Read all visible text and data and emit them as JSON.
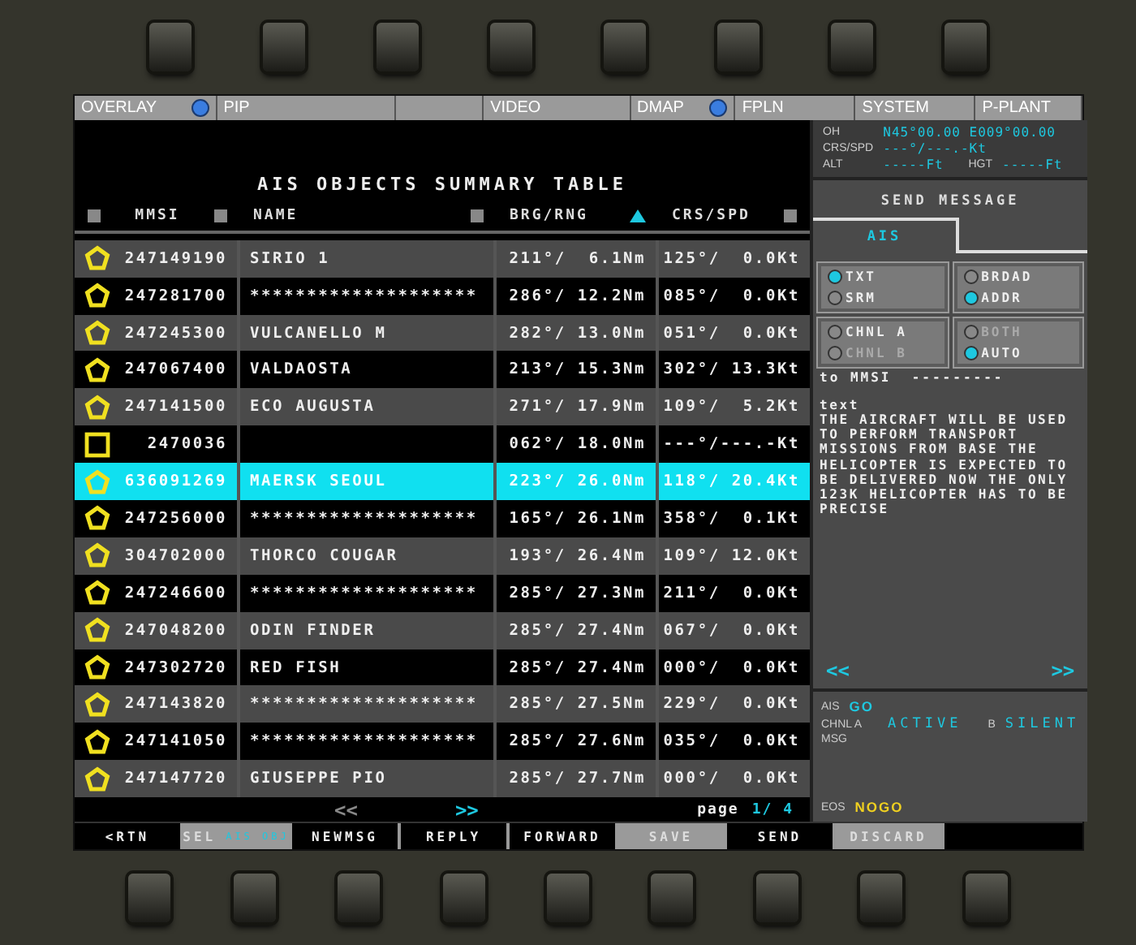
{
  "menu_bar": [
    {
      "label": "OVERLAY",
      "indicator": true
    },
    {
      "label": "PIP",
      "indicator": false
    },
    {
      "indicator": false
    },
    {
      "label": "VIDEO",
      "indicator": false
    },
    {
      "label": "DMAP",
      "indicator": true
    },
    {
      "label": "FPLN",
      "indicator": false
    },
    {
      "label": "SYSTEM",
      "indicator": false
    },
    {
      "label": "P-PLANT",
      "indicator": false
    }
  ],
  "table": {
    "title": "AIS OBJECTS SUMMARY TABLE",
    "columns": [
      "MMSI",
      "NAME",
      "BRG/RNG",
      "CRS/SPD"
    ],
    "rows": [
      {
        "kind": "pentagon",
        "selected": false,
        "mmsi": "247149190",
        "name": "SIRIO 1",
        "brg_rng": "211°/  6.1Nm",
        "crs_spd": "125°/  0.0Kt"
      },
      {
        "kind": "pentagon",
        "selected": false,
        "mmsi": "247281700",
        "name": "********************",
        "brg_rng": "286°/ 12.2Nm",
        "crs_spd": "085°/  0.0Kt"
      },
      {
        "kind": "pentagon",
        "selected": false,
        "mmsi": "247245300",
        "name": "VULCANELLO M",
        "brg_rng": "282°/ 13.0Nm",
        "crs_spd": "051°/  0.0Kt"
      },
      {
        "kind": "pentagon",
        "selected": false,
        "mmsi": "247067400",
        "name": "VALDAOSTA",
        "brg_rng": "213°/ 15.3Nm",
        "crs_spd": "302°/ 13.3Kt"
      },
      {
        "kind": "pentagon",
        "selected": false,
        "mmsi": "247141500",
        "name": "ECO AUGUSTA",
        "brg_rng": "271°/ 17.9Nm",
        "crs_spd": "109°/  5.2Kt"
      },
      {
        "kind": "square",
        "selected": false,
        "mmsi": "2470036",
        "name": "",
        "brg_rng": "062°/ 18.0Nm",
        "crs_spd": "---°/---.-Kt"
      },
      {
        "kind": "pentagon",
        "selected": true,
        "mmsi": "636091269",
        "name": "MAERSK SEOUL",
        "brg_rng": "223°/ 26.0Nm",
        "crs_spd": "118°/ 20.4Kt"
      },
      {
        "kind": "pentagon",
        "selected": false,
        "mmsi": "247256000",
        "name": "********************",
        "brg_rng": "165°/ 26.1Nm",
        "crs_spd": "358°/  0.1Kt"
      },
      {
        "kind": "pentagon",
        "selected": false,
        "mmsi": "304702000",
        "name": "THORCO COUGAR",
        "brg_rng": "193°/ 26.4Nm",
        "crs_spd": "109°/ 12.0Kt"
      },
      {
        "kind": "pentagon",
        "selected": false,
        "mmsi": "247246600",
        "name": "********************",
        "brg_rng": "285°/ 27.3Nm",
        "crs_spd": "211°/  0.0Kt"
      },
      {
        "kind": "pentagon",
        "selected": false,
        "mmsi": "247048200",
        "name": "ODIN FINDER",
        "brg_rng": "285°/ 27.4Nm",
        "crs_spd": "067°/  0.0Kt"
      },
      {
        "kind": "pentagon",
        "selected": false,
        "mmsi": "247302720",
        "name": "RED FISH",
        "brg_rng": "285°/ 27.4Nm",
        "crs_spd": "000°/  0.0Kt"
      },
      {
        "kind": "pentagon",
        "selected": false,
        "mmsi": "247143820",
        "name": "********************",
        "brg_rng": "285°/ 27.5Nm",
        "crs_spd": "229°/  0.0Kt"
      },
      {
        "kind": "pentagon",
        "selected": false,
        "mmsi": "247141050",
        "name": "********************",
        "brg_rng": "285°/ 27.6Nm",
        "crs_spd": "035°/  0.0Kt"
      },
      {
        "kind": "pentagon",
        "selected": false,
        "mmsi": "247147720",
        "name": "GIUSEPPE PIO",
        "brg_rng": "285°/ 27.7Nm",
        "crs_spd": "000°/  0.0Kt"
      }
    ],
    "pager": {
      "prev": "<<",
      "next": ">>",
      "label": "page",
      "page": "1/",
      "total": "4"
    }
  },
  "position": [
    {
      "label": "OH",
      "value": "N45°00.00 E009°00.00"
    },
    {
      "label": "CRS/SPD",
      "value": "---°/---.-Kt"
    },
    {
      "label": "ALT",
      "value": "-----Ft"
    },
    {
      "label": "HGT",
      "value": "-----Ft"
    }
  ],
  "send_message": {
    "title": "SEND MESSAGE",
    "tab": "AIS",
    "radio_groups": [
      [
        {
          "label": "TXT",
          "selected": true,
          "disabled": false
        },
        {
          "label": "SRM",
          "selected": false,
          "disabled": false
        }
      ],
      [
        {
          "label": "BRDAD",
          "selected": false,
          "disabled": false
        },
        {
          "label": "ADDR",
          "selected": true,
          "disabled": false
        }
      ],
      [
        {
          "label": "CHNL A",
          "selected": false,
          "disabled": false
        },
        {
          "label": "CHNL B",
          "selected": false,
          "disabled": true
        }
      ],
      [
        {
          "label": "BOTH",
          "selected": false,
          "disabled": true
        },
        {
          "label": "AUTO",
          "selected": true,
          "disabled": false
        }
      ]
    ],
    "to_label": "to MMSI",
    "to_value": "---------",
    "text_label": "text",
    "text": "THE AIRCRAFT WILL BE USED TO PERFORM TRANSPORT MISSIONS FROM BASE THE HELICOPTER IS EXPECTED TO BE DELIVERED NOW THE ONLY 123K HELICOPTER HAS TO BE PRECISE",
    "prev": "<<",
    "next": ">>"
  },
  "status": {
    "ais_label": "AIS",
    "ais": "GO",
    "chnl_label": "CHNL A",
    "chnl_a": "ACTIVE",
    "b_label": "B",
    "chnl_b": "SILENT",
    "msg_label": "MSG",
    "eos_label": "EOS",
    "eos": "NOGO"
  },
  "softkeys": [
    {
      "label": "<RTN",
      "active": false
    },
    {
      "label": "SEL",
      "sub": "AIS OBJ",
      "active": true
    },
    {
      "label": "NEWMSG",
      "active": false
    },
    {
      "label": "REPLY",
      "active": false
    },
    {
      "label": "FORWARD",
      "active": false
    },
    {
      "label": "SAVE",
      "active": true
    },
    {
      "label": "SEND",
      "active": false
    },
    {
      "label": "DISCARD",
      "active": true
    }
  ]
}
